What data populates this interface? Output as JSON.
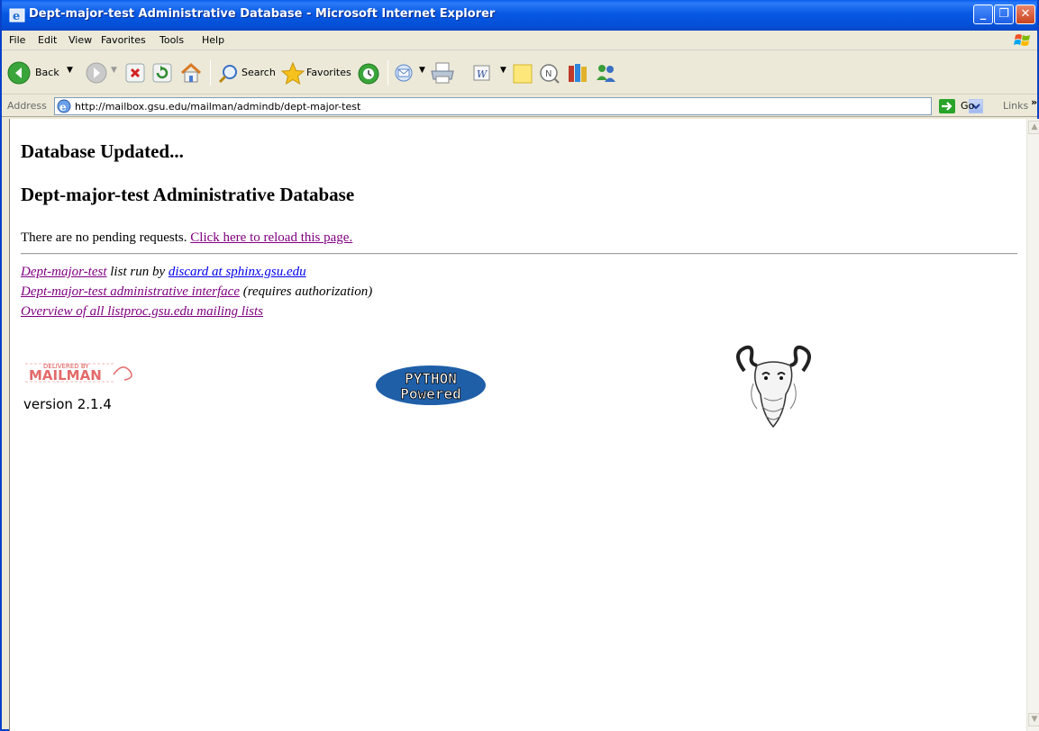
{
  "window": {
    "title": "Dept-major-test Administrative Database - Microsoft Internet Explorer"
  },
  "menu": [
    "File",
    "Edit",
    "View",
    "Favorites",
    "Tools",
    "Help"
  ],
  "toolbar": {
    "back_label": "Back",
    "search_label": "Search",
    "favorites_label": "Favorites"
  },
  "address": {
    "label": "Address",
    "url": "http://mailbox.gsu.edu/mailman/admindb/dept-major-test",
    "go_label": "Go",
    "links_label": "Links",
    "links_chevron": "»"
  },
  "page": {
    "heading_updated": "Database Updated...",
    "heading_title": "Dept-major-test Administrative Database",
    "pending_text": "There are no pending requests.",
    "reload_link": "Click here to reload this page.",
    "footer": {
      "list_link": "Dept-major-test",
      "list_run_by": " list run by ",
      "owner_link": "discard at sphinx.gsu.edu",
      "admin_link": "Dept-major-test administrative interface",
      "admin_note": " (requires authorization)",
      "overview_link": "Overview of all listproc.gsu.edu mailing lists"
    },
    "mailman_logo_text": "MAILMAN",
    "mailman_logo_sub": "DELIVERED BY",
    "version": "version 2.1.4",
    "python_logo_line1": "PYTHON",
    "python_logo_line2": "Powered"
  },
  "colors": {
    "titlebar": "#0758e3",
    "visited_link": "#800080",
    "link": "#0000ee"
  }
}
